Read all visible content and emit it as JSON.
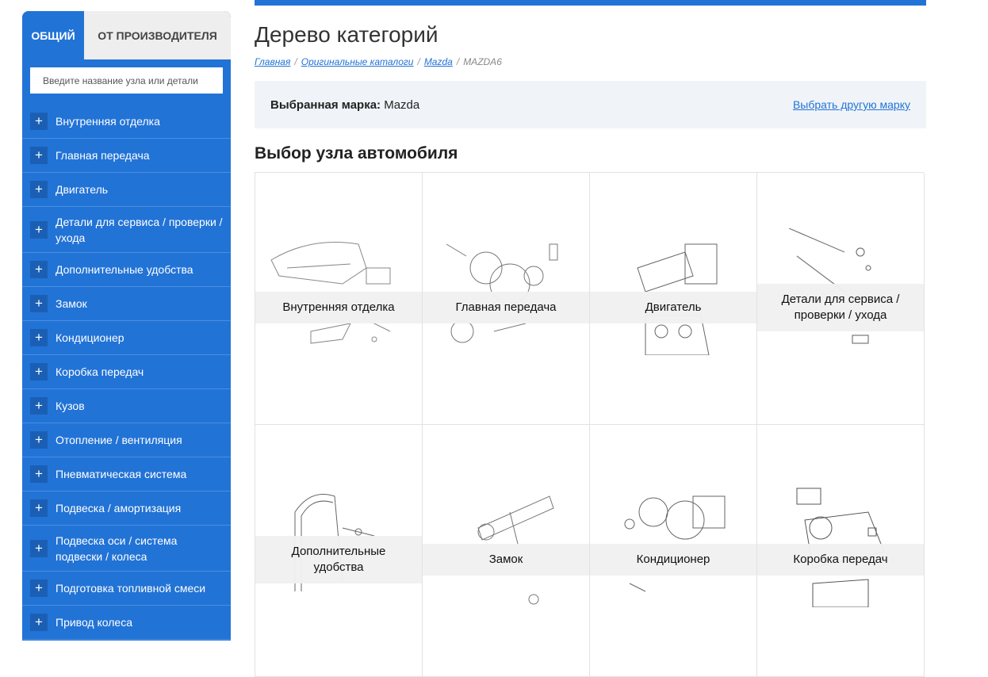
{
  "sidebar": {
    "tabs": [
      {
        "label": "ОБЩИЙ"
      },
      {
        "label": "ОТ ПРОИЗВОДИТЕЛЯ"
      }
    ],
    "search": {
      "placeholder": "Введите название узла или детали"
    },
    "items": [
      {
        "label": "Внутренняя отделка"
      },
      {
        "label": "Главная передача"
      },
      {
        "label": "Двигатель"
      },
      {
        "label": "Детали для сервиса / проверки / ухода"
      },
      {
        "label": "Дополнительные удобства"
      },
      {
        "label": "Замок"
      },
      {
        "label": "Кондиционер"
      },
      {
        "label": "Коробка передач"
      },
      {
        "label": "Кузов"
      },
      {
        "label": "Отопление / вентиляция"
      },
      {
        "label": "Пневматическая система"
      },
      {
        "label": "Подвеска / амортизация"
      },
      {
        "label": "Подвеска оси / система подвески / колеса"
      },
      {
        "label": "Подготовка топливной смеси"
      },
      {
        "label": "Привод колеса"
      }
    ],
    "plus_symbol": "+"
  },
  "header": {
    "title": "Дерево категорий",
    "breadcrumb": [
      {
        "label": "Главная"
      },
      {
        "label": "Оригинальные каталоги"
      },
      {
        "label": "Mazda"
      },
      {
        "label": "MAZDA6"
      }
    ],
    "breadcrumb_sep": "/"
  },
  "brand": {
    "label": "Выбранная марка:",
    "value": "Mazda",
    "change_link": "Выбрать другую марку"
  },
  "section": {
    "title": "Выбор узла автомобиля"
  },
  "cards": [
    {
      "label": "Внутренняя отделка"
    },
    {
      "label": "Главная передача"
    },
    {
      "label": "Двигатель"
    },
    {
      "label": "Детали для сервиса / проверки / ухода"
    },
    {
      "label": "Дополнительные удобства"
    },
    {
      "label": "Замок"
    },
    {
      "label": "Кондиционер"
    },
    {
      "label": "Коробка передач"
    }
  ],
  "colors": {
    "accent": "#2273d6",
    "sidebar_bg": "#2273d6",
    "plus_bg": "#1b5fb5",
    "brand_box_bg": "#f0f4f8"
  }
}
